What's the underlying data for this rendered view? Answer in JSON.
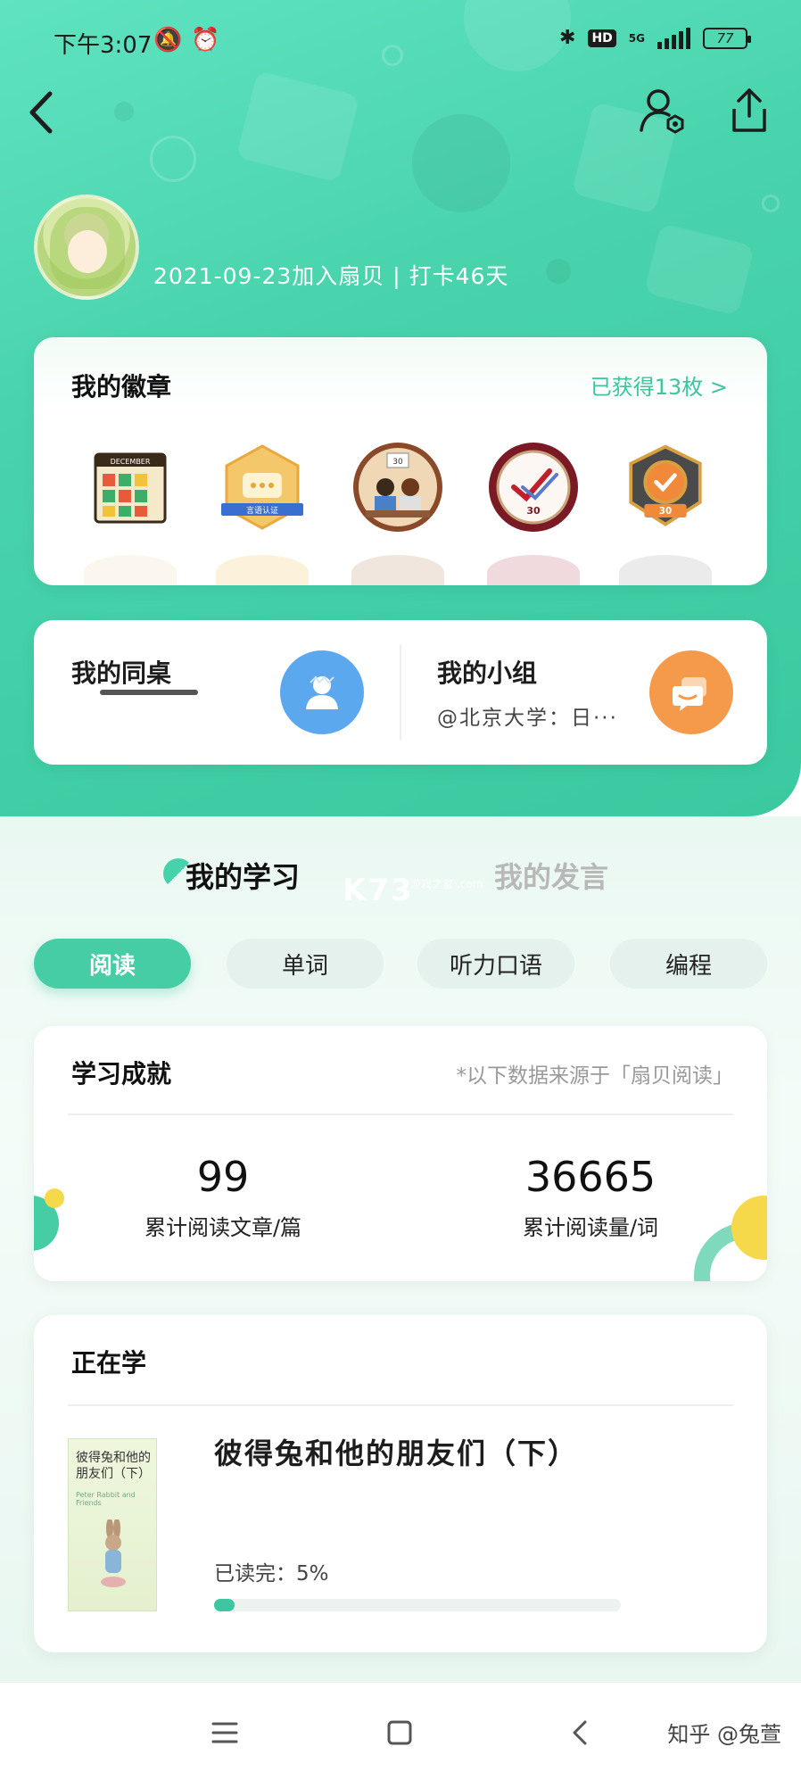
{
  "status_bar": {
    "time": "下午3:07",
    "left_icons": "🔕⏰",
    "hd": "HD",
    "network": "5G",
    "battery": "77"
  },
  "profile": {
    "join_info": "2021-09-23加入扇贝 | 打卡46天"
  },
  "badges": {
    "title": "我的徽章",
    "more": "已获得13枚 >",
    "items": [
      "DECEMBER",
      "言语认证",
      "30",
      "30",
      "30"
    ]
  },
  "social": {
    "desk_title": "我的同桌",
    "group_title": "我的小组",
    "group_name": "@北京大学：日···"
  },
  "tabs": {
    "active": "我的学习",
    "inactive": "我的发言"
  },
  "watermark": {
    "main": "K73",
    "sub": "游戏之家 .com"
  },
  "categories": [
    {
      "label": "阅读",
      "active": true
    },
    {
      "label": "单词",
      "active": false
    },
    {
      "label": "听力口语",
      "active": false
    },
    {
      "label": "编程",
      "active": false
    }
  ],
  "achievement": {
    "title": "学习成就",
    "note": "*以下数据来源于「扇贝阅读」",
    "stats": [
      {
        "value": "99",
        "label": "累计阅读文章/篇"
      },
      {
        "value": "36665",
        "label": "累计阅读量/词"
      }
    ]
  },
  "learning": {
    "title": "正在学",
    "book_title": "彼得兔和他的朋友们（下）",
    "cover_title": "彼得兔和他的朋友们（下）",
    "cover_subtitle": "Peter Rabbit and Friends",
    "progress_label": "已读完：5%",
    "progress": 0.05
  },
  "credit": "知乎 @兔萱",
  "colors": {
    "primary": "#47cda6",
    "accent_orange": "#f59a4b",
    "accent_blue": "#5ca8ee"
  }
}
